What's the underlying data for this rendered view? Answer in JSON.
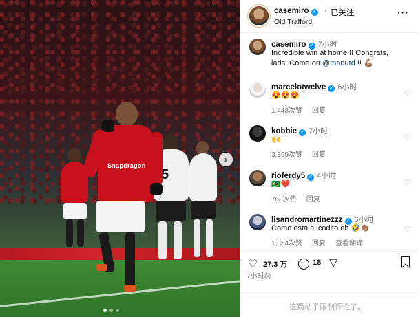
{
  "post": {
    "author": "casemiro",
    "follow_state": "已关注",
    "separator": "·",
    "location": "Old Trafford",
    "caption_time": "7小时",
    "caption_line1": "Incredible win at home !! Congrats,",
    "caption_line2_prefix": "lads. Come on ",
    "caption_mention": "@manutd",
    "caption_suffix": " !! 💪🏽",
    "photo_sponsor": "Snapdragon",
    "photo_number": "5"
  },
  "comments": [
    {
      "user": "marcelotwelve",
      "time": "6小时",
      "text": "😍😍😍",
      "likes": "1,448次赞",
      "reply": "回复"
    },
    {
      "user": "kobbie",
      "time": "7小时",
      "text": "🙌",
      "likes": "3,399次赞",
      "reply": "回复"
    },
    {
      "user": "rioferdy5",
      "time": "4小时",
      "text": "🇧🇷❤️",
      "likes": "768次赞",
      "reply": "回复"
    },
    {
      "user": "lisandromartinezzz",
      "time": "6小时",
      "text": "Como está el codito eh 🤣👏🏽",
      "likes": "1,354次赞",
      "reply": "回复",
      "translate": "查看翻译"
    }
  ],
  "actions": {
    "likes": "27.3 万",
    "comments": "18"
  },
  "post_time": "7小时前",
  "comments_limited": "这篇帖子限制评论了。",
  "icons": {
    "more": "more-horizontal-icon",
    "like": "heart-icon",
    "comment": "comment-icon",
    "share": "share-icon",
    "save": "bookmark-icon"
  },
  "colors": {
    "verified": "#0095f6",
    "mention": "#00376b",
    "muted": "#737373",
    "kit_red": "#c8101d"
  }
}
